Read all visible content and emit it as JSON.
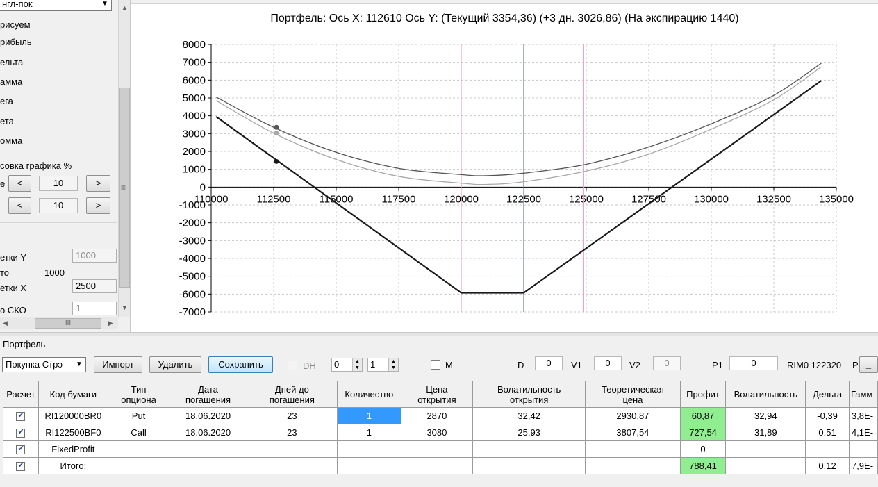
{
  "left_panel": {
    "strategy_combo": "нгл-пок",
    "section_header": "рисуем",
    "options": [
      "рибыль",
      "ельта",
      "амма",
      "ега",
      "ета",
      "омма"
    ],
    "shift_header": "совка графика %",
    "row1_label": "е",
    "row1_value": "10",
    "row2_value": "10",
    "btn_left": "<",
    "btn_right": ">",
    "grid_y_label": "етки Y",
    "grid_y_value": "1000",
    "auto_label": "то",
    "auto_value": "1000",
    "grid_x_label": "етки X",
    "grid_x_value": "2500",
    "sko_label": "о СКО",
    "sko_value": "1",
    "hscroll_grip": "III"
  },
  "chart": {
    "title": "Портфель: Ось X: 112610 Ось Y:  (Текущий 3354,36)  (+3 дн. 3026,86)  (На экспирацию 1440)"
  },
  "chart_data": {
    "type": "line",
    "xlim": [
      110000,
      135000
    ],
    "ylim": [
      -7000,
      8000
    ],
    "x_ticks": [
      110000,
      112500,
      115000,
      117500,
      120000,
      122500,
      125000,
      127500,
      130000,
      132500,
      135000
    ],
    "y_ticks": [
      8000,
      7000,
      6000,
      5000,
      4000,
      3000,
      2000,
      1000,
      0,
      -1000,
      -2000,
      -3000,
      -4000,
      -5000,
      -6000,
      -7000
    ],
    "grid": true,
    "vertical_lines": [
      {
        "x": 120000,
        "color": "#f4a4b4"
      },
      {
        "x": 122500,
        "color": "#6a7f95"
      },
      {
        "x": 124900,
        "color": "#f4a4b4"
      }
    ],
    "series": [
      {
        "color": "#1a1a1a",
        "width": 2.2,
        "x": [
          110200,
          120000,
          122500,
          134400
        ],
        "y": [
          3950,
          -5930,
          -5930,
          5970
        ]
      },
      {
        "color": "#555555",
        "width": 1.3,
        "x": [
          110200,
          112500,
          115000,
          117500,
          120000,
          121000,
          122500,
          125000,
          127500,
          130000,
          132500,
          134400
        ],
        "y": [
          5050,
          3354,
          1950,
          1050,
          700,
          640,
          780,
          1280,
          2250,
          3550,
          5150,
          6950
        ]
      },
      {
        "color": "#a8a8a8",
        "width": 1.3,
        "x": [
          110200,
          112500,
          115000,
          117500,
          120000,
          121000,
          122500,
          125000,
          127500,
          130000,
          132500,
          134400
        ],
        "y": [
          4850,
          3027,
          1550,
          600,
          220,
          150,
          300,
          900,
          1850,
          3250,
          4900,
          6750
        ]
      }
    ],
    "markers": [
      {
        "x": 112610,
        "y": 3354,
        "color": "#555555"
      },
      {
        "x": 112610,
        "y": 3027,
        "color": "#a8a8a8"
      },
      {
        "x": 112610,
        "y": 1440,
        "color": "#1a1a1a"
      }
    ]
  },
  "portfolio": {
    "group_title": "Портфель",
    "buy_combo": "Покупка Стрэ",
    "import_btn": "Импорт",
    "delete_btn": "Удалить",
    "save_btn": "Сохранить",
    "dh_label": "DH",
    "spin1": "0",
    "spin2": "1",
    "m_label": "M",
    "d_label": "D",
    "d_value": "0",
    "v1_label": "V1",
    "v1_value": "0",
    "v2_label": "V2",
    "v2_value": "0",
    "p1_label": "P1",
    "p1_value": "0",
    "rim_label": "RIM0 122320",
    "p_label": "P",
    "p_btn": "_"
  },
  "table": {
    "headers": [
      "Расчет",
      "Код бумаги",
      "Тип\nопциона",
      "Дата\nпогашения",
      "Дней до\nпогашения",
      "Количество",
      "Цена\nоткрытия",
      "Волатильность\nоткрытия",
      "Теоретическая\nцена",
      "Профит",
      "Волатильность",
      "Дельта",
      "Гамм"
    ],
    "rows": [
      [
        "",
        "RI120000BR0",
        "Put",
        "18.06.2020",
        "23",
        "1",
        "2870",
        "32,42",
        "2930,87",
        "60,87",
        "32,94",
        "-0,39",
        "3,8E-"
      ],
      [
        "",
        "RI122500BF0",
        "Call",
        "18.06.2020",
        "23",
        "1",
        "3080",
        "25,93",
        "3807,54",
        "727,54",
        "31,89",
        "0,51",
        "4,1E-"
      ],
      [
        "",
        "FixedProfit",
        "",
        "",
        "",
        "",
        "",
        "",
        "",
        "0",
        "",
        "",
        ""
      ],
      [
        "",
        "Итого:",
        "",
        "",
        "",
        "",
        "",
        "",
        "",
        "788,41",
        "",
        "0,12",
        "7,9E-"
      ]
    ]
  }
}
